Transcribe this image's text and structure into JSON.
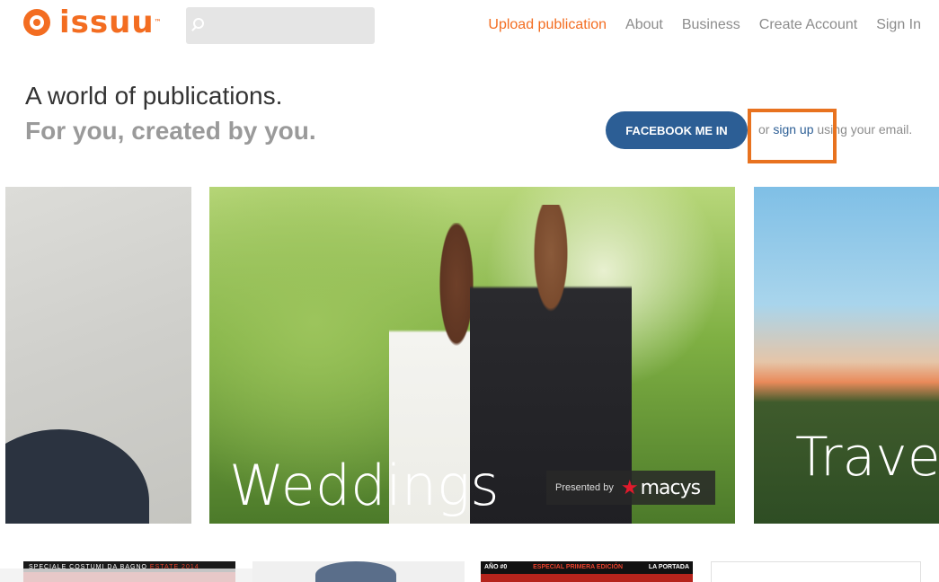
{
  "brand": {
    "name": "issuu",
    "logo_icon": "issuu-logo-icon",
    "accent": "#f36d21"
  },
  "search": {
    "placeholder": "",
    "icon": "search-icon"
  },
  "nav": {
    "upload": "Upload publication",
    "about": "About",
    "business": "Business",
    "create_account": "Create Account",
    "sign_in": "Sign In"
  },
  "hero": {
    "headline": "A world of publications.",
    "subline": "For you, created by you.",
    "facebook_button": "FACEBOOK ME IN",
    "or_prefix": "or ",
    "signup_link": "sign up",
    "or_suffix": " using your email.",
    "button_color": "#2c5e95",
    "highlight_color": "#e8721f"
  },
  "tiles": {
    "main_label": "Weddings",
    "sponsor_prefix": "Presented by",
    "sponsor_brand": "macys",
    "right_label": "Travel"
  },
  "thumbnails": {
    "thumb1_caption_a": "SPECIALE COSTUMI DA BAGNO ",
    "thumb1_caption_b": "ESTATE 2014",
    "thumb3_caption_a": "AÑO #0",
    "thumb3_caption_b": "ESPECIAL PRIMERA EDICIÓN",
    "thumb3_caption_c": "LA PORTADA"
  }
}
